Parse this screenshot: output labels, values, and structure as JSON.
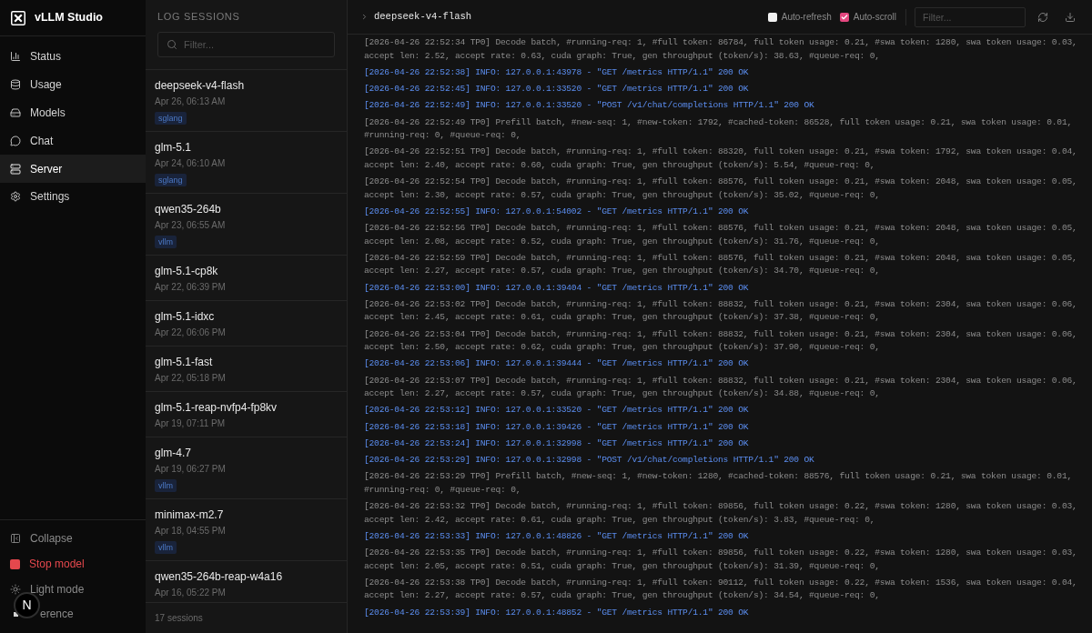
{
  "sidebar": {
    "brand": "vLLM Studio",
    "nav": [
      {
        "label": "Status",
        "selected": false
      },
      {
        "label": "Usage",
        "selected": false
      },
      {
        "label": "Models",
        "selected": false
      },
      {
        "label": "Chat",
        "selected": false
      },
      {
        "label": "Server",
        "selected": true
      },
      {
        "label": "Settings",
        "selected": false
      }
    ],
    "footer": [
      {
        "kind": "collapse",
        "label": "Collapse"
      },
      {
        "kind": "stop",
        "label": "Stop model"
      },
      {
        "kind": "theme",
        "label": "Light mode"
      },
      {
        "kind": "covered",
        "label": "erence"
      }
    ]
  },
  "dev_indicator": {
    "label": "N"
  },
  "sessions": {
    "title": "LOG SESSIONS",
    "filter": {
      "placeholder": "Filter..."
    },
    "items": [
      {
        "name": "deepseek-v4-flash",
        "date": "Apr 26, 06:13 AM",
        "tag": "sglang"
      },
      {
        "name": "glm-5.1",
        "date": "Apr 24, 06:10 AM",
        "tag": "sglang"
      },
      {
        "name": "qwen35-264b",
        "date": "Apr 23, 06:55 AM",
        "tag": "vllm"
      },
      {
        "name": "glm-5.1-cp8k",
        "date": "Apr 22, 06:39 PM"
      },
      {
        "name": "glm-5.1-idxc",
        "date": "Apr 22, 06:06 PM"
      },
      {
        "name": "glm-5.1-fast",
        "date": "Apr 22, 05:18 PM"
      },
      {
        "name": "glm-5.1-reap-nvfp4-fp8kv",
        "date": "Apr 19, 07:11 PM"
      },
      {
        "name": "glm-4.7",
        "date": "Apr 19, 06:27 PM",
        "tag": "vllm"
      },
      {
        "name": "minimax-m2.7",
        "date": "Apr 18, 04:55 PM",
        "tag": "vllm"
      },
      {
        "name": "qwen35-264b-reap-w4a16",
        "date": "Apr 16, 05:22 PM"
      }
    ],
    "count": "17 sessions"
  },
  "log": {
    "title": "deepseek-v4-flash",
    "auto_refresh": {
      "label": "Auto-refresh",
      "checked": false
    },
    "auto_scroll": {
      "label": "Auto-scroll",
      "checked": true
    },
    "filter": {
      "placeholder": "Filter..."
    },
    "entries": [
      {
        "kind": "engine",
        "text": "[2026-04-26 22:52:34 TP0] Decode batch, #running-req: 1, #full token: 86784, full token usage: 0.21, #swa token: 1280, swa token usage: 0.03, accept len: 2.52, accept rate: 0.63, cuda graph: True, gen throughput (token/s): 38.63, #queue-req: 0,"
      },
      {
        "kind": "info",
        "text": "[2026-04-26 22:52:38] INFO: 127.0.0.1:43978 - \"GET /metrics HTTP/1.1\" 200 OK"
      },
      {
        "kind": "info",
        "text": "[2026-04-26 22:52:45] INFO: 127.0.0.1:33520 - \"GET /metrics HTTP/1.1\" 200 OK"
      },
      {
        "kind": "info",
        "text": "[2026-04-26 22:52:49] INFO: 127.0.0.1:33520 - \"POST /v1/chat/completions HTTP/1.1\" 200 OK"
      },
      {
        "kind": "engine",
        "text": "[2026-04-26 22:52:49 TP0] Prefill batch, #new-seq: 1, #new-token: 1792, #cached-token: 86528, full token usage: 0.21, swa token usage: 0.01, #running-req: 0, #queue-req: 0,"
      },
      {
        "kind": "engine",
        "text": "[2026-04-26 22:52:51 TP0] Decode batch, #running-req: 1, #full token: 88320, full token usage: 0.21, #swa token: 1792, swa token usage: 0.04, accept len: 2.40, accept rate: 0.60, cuda graph: True, gen throughput (token/s): 5.54, #queue-req: 0,"
      },
      {
        "kind": "engine",
        "text": "[2026-04-26 22:52:54 TP0] Decode batch, #running-req: 1, #full token: 88576, full token usage: 0.21, #swa token: 2048, swa token usage: 0.05, accept len: 2.30, accept rate: 0.57, cuda graph: True, gen throughput (token/s): 35.02, #queue-req: 0,"
      },
      {
        "kind": "info",
        "text": "[2026-04-26 22:52:55] INFO: 127.0.0.1:54002 - \"GET /metrics HTTP/1.1\" 200 OK"
      },
      {
        "kind": "engine",
        "text": "[2026-04-26 22:52:56 TP0] Decode batch, #running-req: 1, #full token: 88576, full token usage: 0.21, #swa token: 2048, swa token usage: 0.05, accept len: 2.08, accept rate: 0.52, cuda graph: True, gen throughput (token/s): 31.76, #queue-req: 0,"
      },
      {
        "kind": "engine",
        "text": "[2026-04-26 22:52:59 TP0] Decode batch, #running-req: 1, #full token: 88576, full token usage: 0.21, #swa token: 2048, swa token usage: 0.05, accept len: 2.27, accept rate: 0.57, cuda graph: True, gen throughput (token/s): 34.70, #queue-req: 0,"
      },
      {
        "kind": "info",
        "text": "[2026-04-26 22:53:00] INFO: 127.0.0.1:39404 - \"GET /metrics HTTP/1.1\" 200 OK"
      },
      {
        "kind": "engine",
        "text": "[2026-04-26 22:53:02 TP0] Decode batch, #running-req: 1, #full token: 88832, full token usage: 0.21, #swa token: 2304, swa token usage: 0.06, accept len: 2.45, accept rate: 0.61, cuda graph: True, gen throughput (token/s): 37.38, #queue-req: 0,"
      },
      {
        "kind": "engine",
        "text": "[2026-04-26 22:53:04 TP0] Decode batch, #running-req: 1, #full token: 88832, full token usage: 0.21, #swa token: 2304, swa token usage: 0.06, accept len: 2.50, accept rate: 0.62, cuda graph: True, gen throughput (token/s): 37.90, #queue-req: 0,"
      },
      {
        "kind": "info",
        "text": "[2026-04-26 22:53:06] INFO: 127.0.0.1:39444 - \"GET /metrics HTTP/1.1\" 200 OK"
      },
      {
        "kind": "engine",
        "text": "[2026-04-26 22:53:07 TP0] Decode batch, #running-req: 1, #full token: 88832, full token usage: 0.21, #swa token: 2304, swa token usage: 0.06, accept len: 2.27, accept rate: 0.57, cuda graph: True, gen throughput (token/s): 34.88, #queue-req: 0,"
      },
      {
        "kind": "info",
        "text": "[2026-04-26 22:53:12] INFO: 127.0.0.1:33520 - \"GET /metrics HTTP/1.1\" 200 OK"
      },
      {
        "kind": "info",
        "text": "[2026-04-26 22:53:18] INFO: 127.0.0.1:39426 - \"GET /metrics HTTP/1.1\" 200 OK"
      },
      {
        "kind": "info",
        "text": "[2026-04-26 22:53:24] INFO: 127.0.0.1:32998 - \"GET /metrics HTTP/1.1\" 200 OK"
      },
      {
        "kind": "info",
        "text": "[2026-04-26 22:53:29] INFO: 127.0.0.1:32998 - \"POST /v1/chat/completions HTTP/1.1\" 200 OK"
      },
      {
        "kind": "engine",
        "text": "[2026-04-26 22:53:29 TP0] Prefill batch, #new-seq: 1, #new-token: 1280, #cached-token: 88576, full token usage: 0.21, swa token usage: 0.01, #running-req: 0, #queue-req: 0,"
      },
      {
        "kind": "engine",
        "text": "[2026-04-26 22:53:32 TP0] Decode batch, #running-req: 1, #full token: 89856, full token usage: 0.22, #swa token: 1280, swa token usage: 0.03, accept len: 2.42, accept rate: 0.61, cuda graph: True, gen throughput (token/s): 3.83, #queue-req: 0,"
      },
      {
        "kind": "info",
        "text": "[2026-04-26 22:53:33] INFO: 127.0.0.1:48826 - \"GET /metrics HTTP/1.1\" 200 OK"
      },
      {
        "kind": "engine",
        "text": "[2026-04-26 22:53:35 TP0] Decode batch, #running-req: 1, #full token: 89856, full token usage: 0.22, #swa token: 1280, swa token usage: 0.03, accept len: 2.05, accept rate: 0.51, cuda graph: True, gen throughput (token/s): 31.39, #queue-req: 0,"
      },
      {
        "kind": "engine",
        "text": "[2026-04-26 22:53:38 TP0] Decode batch, #running-req: 1, #full token: 90112, full token usage: 0.22, #swa token: 1536, swa token usage: 0.04, accept len: 2.27, accept rate: 0.57, cuda graph: True, gen throughput (token/s): 34.54, #queue-req: 0,"
      },
      {
        "kind": "info",
        "text": "[2026-04-26 22:53:39] INFO: 127.0.0.1:48852 - \"GET /metrics HTTP/1.1\" 200 OK"
      }
    ]
  }
}
